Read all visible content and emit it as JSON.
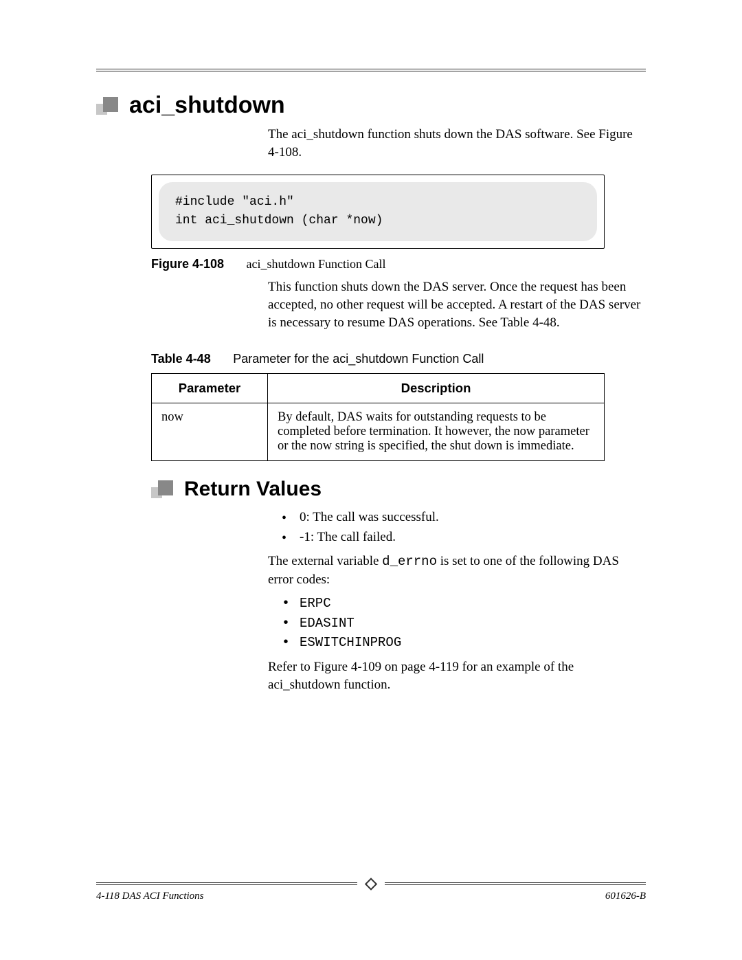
{
  "section": {
    "title": "aci_shutdown",
    "intro": "The aci_shutdown function shuts down the DAS software. See Figure 4-108."
  },
  "figure": {
    "label": "Figure 4-108",
    "caption": "aci_shutdown Function Call",
    "code_line1": "#include \"aci.h\"",
    "code_line2": "int aci_shutdown (char *now)"
  },
  "desc_para": "This function shuts down the DAS server. Once the request has been accepted, no other request will be accepted. A restart of the DAS server is necessary to resume DAS operations. See Table 4-48.",
  "table": {
    "label": "Table 4-48",
    "caption": "Parameter for the aci_shutdown Function Call",
    "headers": {
      "col1": "Parameter",
      "col2": "Description"
    },
    "rows": [
      {
        "param": "now",
        "desc": "By default, DAS waits for outstanding requests to be completed before termination. It however, the now parameter or the now string is specified, the shut down is immediate."
      }
    ]
  },
  "return": {
    "title": "Return Values",
    "items": [
      "0: The call was successful.",
      "-1: The call failed."
    ],
    "para_pre": "The external variable ",
    "para_code": "d_errno",
    "para_post": " is set to one of the following DAS error codes:",
    "codes": [
      "ERPC",
      "EDASINT",
      "ESWITCHINPROG"
    ],
    "closing": "Refer to Figure 4-109 on page 4-119 for an example of the aci_shutdown function."
  },
  "footer": {
    "left": "4-118   DAS ACI Functions",
    "right": "601626-B"
  }
}
